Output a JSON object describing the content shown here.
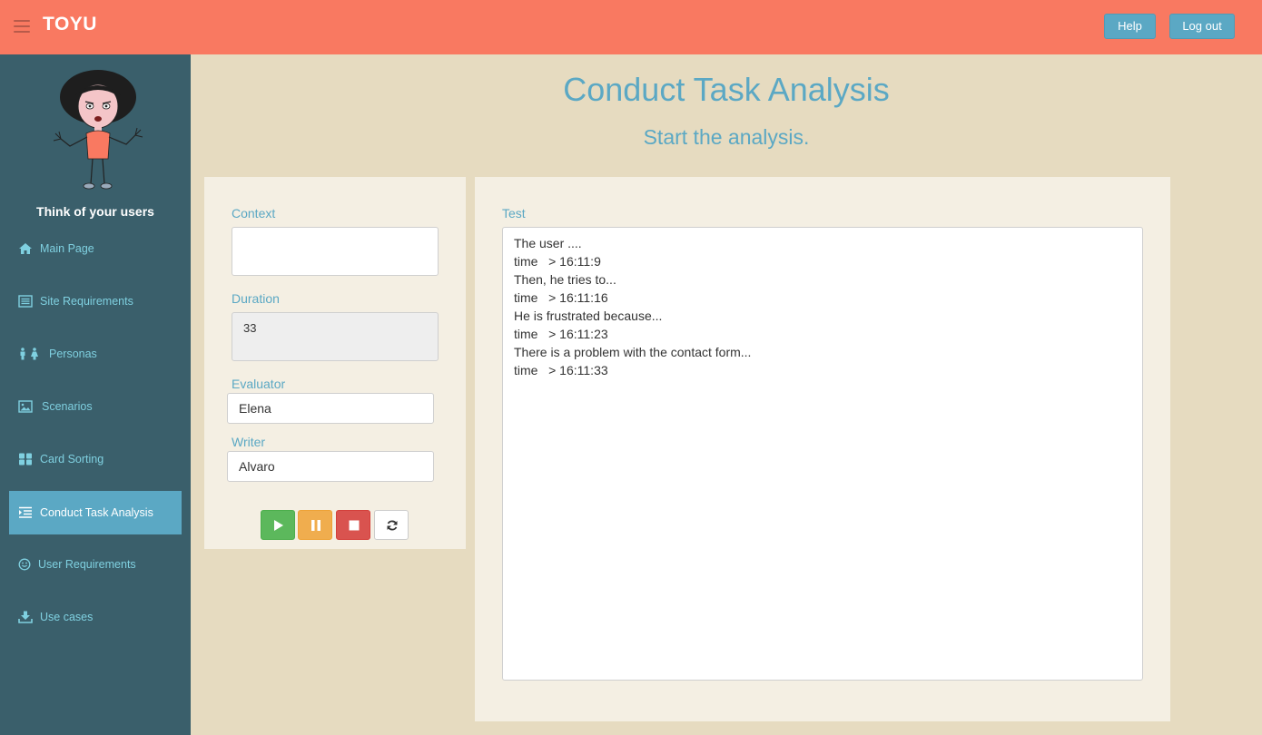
{
  "header": {
    "brand": "TOYU",
    "help_label": "Help",
    "logout_label": "Log out"
  },
  "sidebar": {
    "tagline": "Think of your users",
    "items": [
      {
        "label": "Main Page",
        "icon": "home-icon",
        "active": false
      },
      {
        "label": "Site Requirements",
        "icon": "list-icon",
        "active": false
      },
      {
        "label": "Personas",
        "icon": "personas-icon",
        "active": false
      },
      {
        "label": "Scenarios",
        "icon": "picture-icon",
        "active": false
      },
      {
        "label": "Card Sorting",
        "icon": "grid-icon",
        "active": false
      },
      {
        "label": "Conduct Task Analysis",
        "icon": "indent-icon",
        "active": true
      },
      {
        "label": "User Requirements",
        "icon": "smile-icon",
        "active": false
      },
      {
        "label": "Use cases",
        "icon": "download-icon",
        "active": false
      }
    ]
  },
  "main": {
    "title": "Conduct Task Analysis",
    "subtitle": "Start the analysis.",
    "form": {
      "context_label": "Context",
      "context_value": "",
      "duration_label": "Duration",
      "duration_value": "33",
      "evaluator_label": "Evaluator",
      "evaluator_value": "Elena",
      "writer_label": "Writer",
      "writer_value": "Alvaro"
    },
    "controls": [
      "play-icon",
      "pause-icon",
      "stop-icon",
      "refresh-icon"
    ],
    "test": {
      "label": "Test",
      "lines": [
        "The user ....",
        "time   > 16:11:9",
        "Then, he tries to...",
        "time   > 16:11:16",
        "He is frustrated because...",
        "time   > 16:11:23",
        "There is a problem with the contact form...",
        "time   > 16:11:33"
      ]
    }
  },
  "colors": {
    "header": "#f97961",
    "sidebar": "#3a5f6b",
    "accent": "#5ba8c4",
    "background": "#e6dbc0",
    "panel": "#f4efe3"
  }
}
